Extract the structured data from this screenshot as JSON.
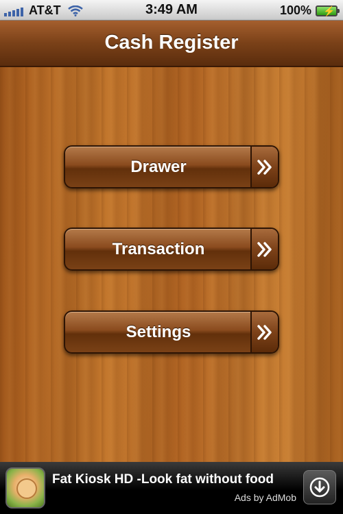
{
  "status_bar": {
    "carrier": "AT&T",
    "time": "3:49 AM",
    "battery": "100%",
    "signal_icon": "signal-bars-icon",
    "wifi_icon": "wifi-icon",
    "battery_icon": "battery-charging-icon"
  },
  "nav": {
    "title": "Cash Register"
  },
  "menu": {
    "items": [
      {
        "label": "Drawer",
        "icon": "double-chevron-right-icon"
      },
      {
        "label": "Transaction",
        "icon": "double-chevron-right-icon"
      },
      {
        "label": "Settings",
        "icon": "double-chevron-right-icon"
      }
    ]
  },
  "ad": {
    "title": "Fat Kiosk HD -Look fat without food",
    "sub": "Ads by AdMob",
    "download_icon": "download-arrow-icon"
  },
  "colors": {
    "nav_brown": "#7a4118",
    "wood": "#b66a26",
    "button_brown": "#8a4b1e"
  }
}
